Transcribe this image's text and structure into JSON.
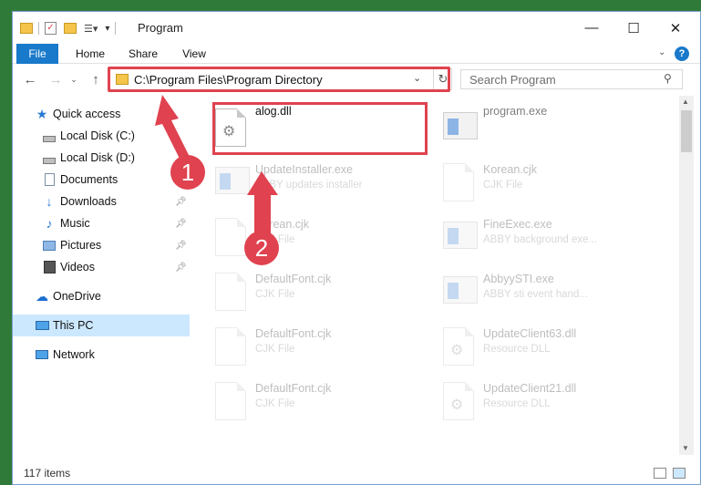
{
  "window": {
    "title": "Program",
    "controls": {
      "minimize": "—",
      "maximize": "☐",
      "close": "✕"
    }
  },
  "ribbon": {
    "tabs": [
      "File",
      "Home",
      "Share",
      "View"
    ],
    "help": "?"
  },
  "address": {
    "path": "C:\\Program Files\\Program Directory",
    "search_placeholder": "Search Program"
  },
  "nav_pane": {
    "quick_access": "Quick access",
    "items": [
      {
        "label": "Local Disk (C:)",
        "icon": "drive-icon",
        "pinned": false
      },
      {
        "label": "Local Disk (D:)",
        "icon": "drive-icon",
        "pinned": false
      },
      {
        "label": "Documents",
        "icon": "documents-icon",
        "pinned": false
      },
      {
        "label": "Downloads",
        "icon": "download-icon",
        "pinned": true
      },
      {
        "label": "Music",
        "icon": "music-icon",
        "pinned": true
      },
      {
        "label": "Pictures",
        "icon": "pictures-icon",
        "pinned": true
      },
      {
        "label": "Videos",
        "icon": "videos-icon",
        "pinned": true
      }
    ],
    "onedrive": "OneDrive",
    "this_pc": "This PC",
    "network": "Network"
  },
  "files": [
    {
      "name": "alog.dll",
      "desc": "",
      "icon": "dll-icon",
      "highlighted": true
    },
    {
      "name": "program.exe",
      "desc": "",
      "icon": "exe-icon",
      "highlighted": false
    },
    {
      "name": "UpdateInstaller.exe",
      "desc": "ABBY updates installer",
      "icon": "exe-icon",
      "highlighted": false
    },
    {
      "name": "Korean.cjk",
      "desc": "CJK File",
      "icon": "file-icon",
      "highlighted": false
    },
    {
      "name": "Korean.cjk",
      "desc": "CJK File",
      "icon": "file-icon",
      "highlighted": false
    },
    {
      "name": "FineExec.exe",
      "desc": "ABBY background exe...",
      "icon": "exe-icon",
      "highlighted": false
    },
    {
      "name": "DefaultFont.cjk",
      "desc": "CJK File",
      "icon": "file-icon",
      "highlighted": false
    },
    {
      "name": "AbbyySTI.exe",
      "desc": "ABBY sti event hand...",
      "icon": "exe-icon",
      "highlighted": false
    },
    {
      "name": "DefaultFont.cjk",
      "desc": "CJK File",
      "icon": "file-icon",
      "highlighted": false
    },
    {
      "name": "UpdateClient63.dll",
      "desc": "Resource DLL",
      "icon": "dll-icon",
      "highlighted": false
    },
    {
      "name": "DefaultFont.cjk",
      "desc": "CJK File",
      "icon": "file-icon",
      "highlighted": false
    },
    {
      "name": "UpdateClient21.dll",
      "desc": "Resource DLL",
      "icon": "dll-icon",
      "highlighted": false
    }
  ],
  "annotations": {
    "step1": "1",
    "step2": "2",
    "color": "#e0424f"
  },
  "status": {
    "count": "117 items"
  }
}
